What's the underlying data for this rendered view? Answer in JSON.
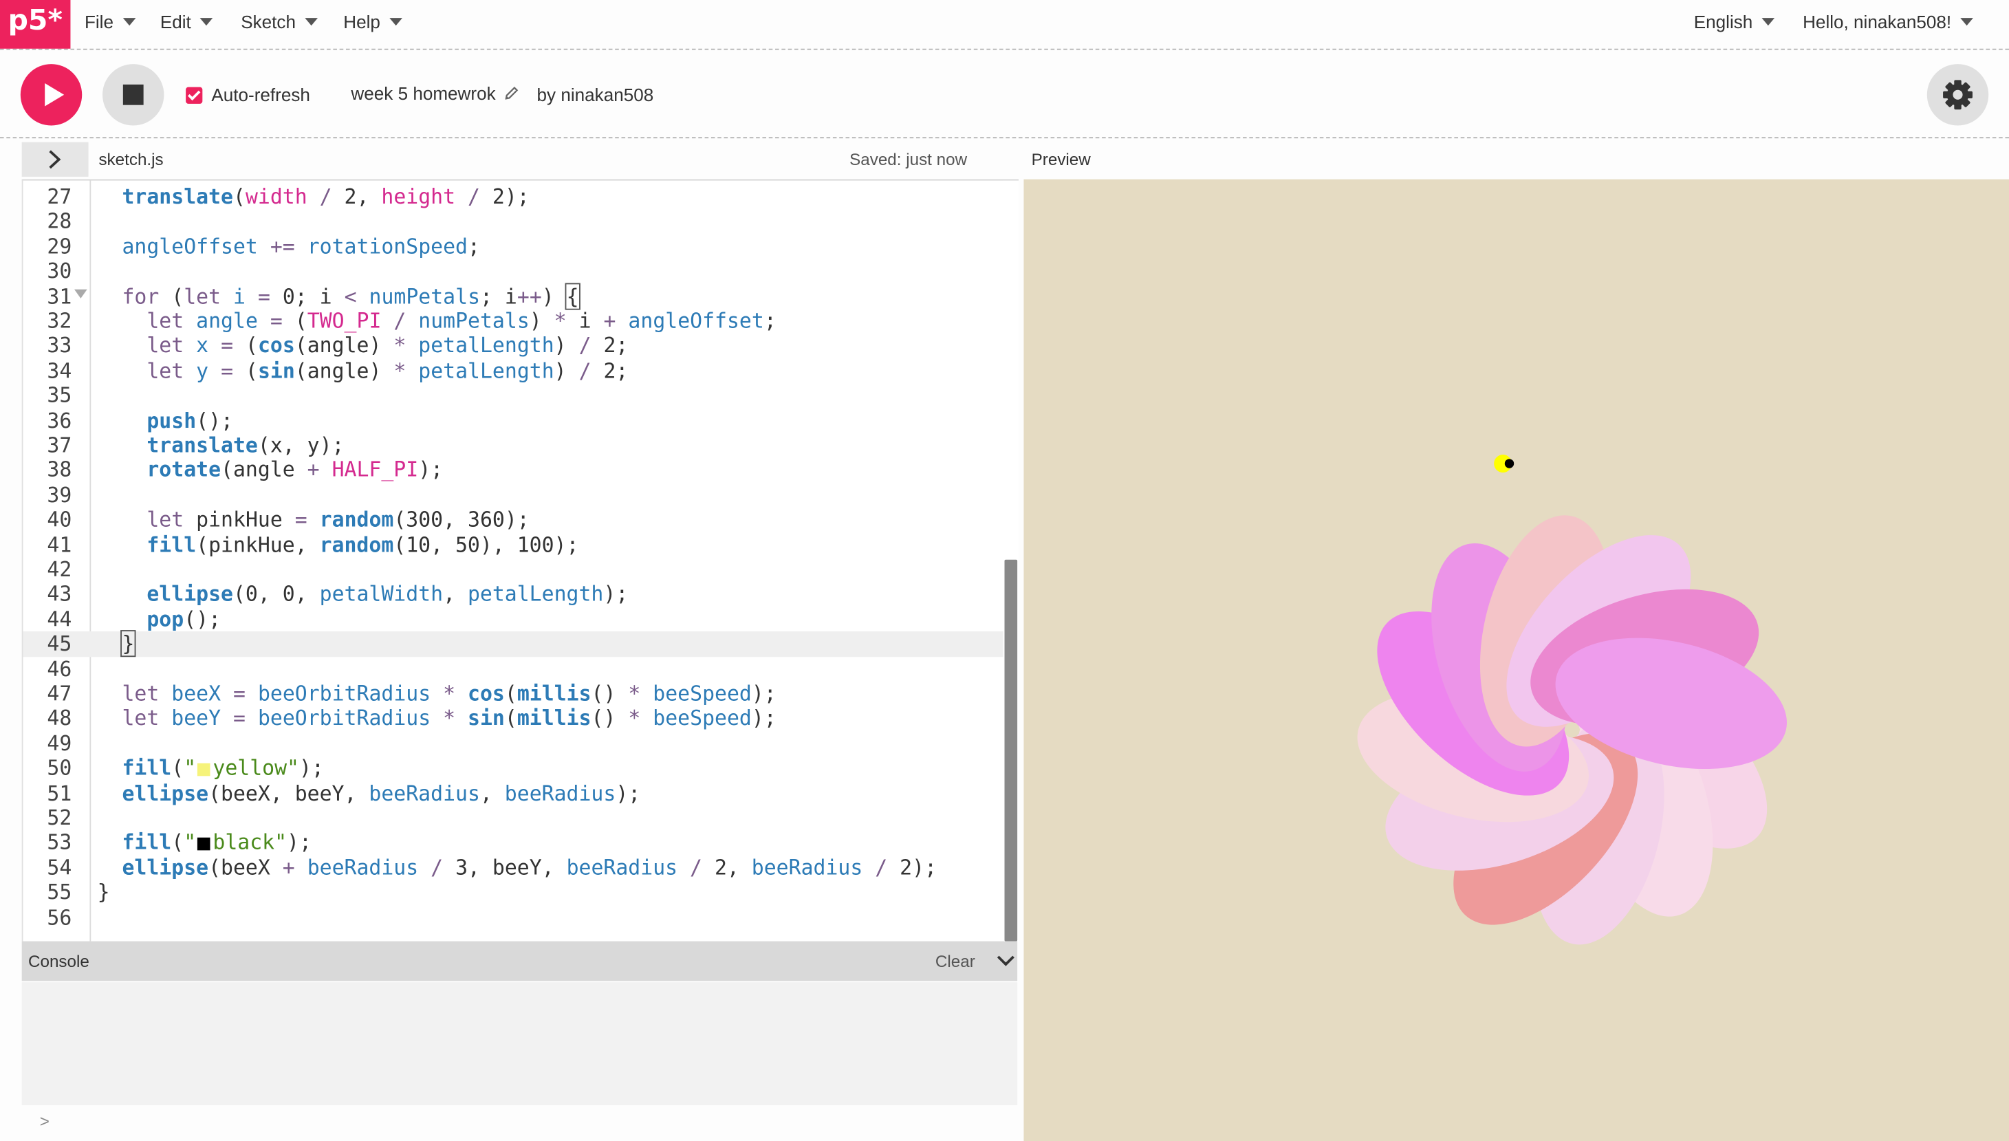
{
  "colors": {
    "accent": "#ed225d",
    "preview_bg": "#e5dbc2"
  },
  "nav": {
    "logo_text": "p5*",
    "menus": [
      "File",
      "Edit",
      "Sketch",
      "Help"
    ],
    "language": "English",
    "user_greeting": "Hello, ninakan508!"
  },
  "toolbar": {
    "play_icon": "play-icon",
    "stop_icon": "stop-icon",
    "auto_refresh_label": "Auto-refresh",
    "auto_refresh_checked": true,
    "sketch_name": "week 5 homewrok",
    "owner_text": "by ninakan508",
    "settings_icon": "gear-icon"
  },
  "editor": {
    "file_name": "sketch.js",
    "saved_status": "Saved: just now",
    "preview_label": "Preview",
    "line_numbers": [
      "27",
      "28",
      "29",
      "30",
      "31",
      "32",
      "33",
      "34",
      "35",
      "36",
      "37",
      "38",
      "39",
      "40",
      "41",
      "42",
      "43",
      "44",
      "45",
      "46",
      "47",
      "48",
      "49",
      "50",
      "51",
      "52",
      "53",
      "54",
      "55",
      "56"
    ],
    "code_lines": [
      "  translate(width / 2, height / 2);",
      "",
      "  angleOffset += rotationSpeed;",
      "",
      "  for (let i = 0; i < numPetals; i++) {",
      "    let angle = (TWO_PI / numPetals) * i + angleOffset;",
      "    let x = (cos(angle) * petalLength) / 2;",
      "    let y = (sin(angle) * petalLength) / 2;",
      "",
      "    push();",
      "    translate(x, y);",
      "    rotate(angle + HALF_PI);",
      "",
      "    let pinkHue = random(300, 360);",
      "    fill(pinkHue, random(10, 50), 100);",
      "",
      "    ellipse(0, 0, petalWidth, petalLength);",
      "    pop();",
      "  }",
      "",
      "  let beeX = beeOrbitRadius * cos(millis() * beeSpeed);",
      "  let beeY = beeOrbitRadius * sin(millis() * beeSpeed);",
      "",
      "  fill(\"yellow\");",
      "  ellipse(beeX, beeY, beeRadius, beeRadius);",
      "",
      "  fill(\"black\");",
      "  ellipse(beeX + beeRadius / 3, beeY, beeRadius / 2, beeRadius / 2);",
      "}",
      ""
    ],
    "active_line": "45"
  },
  "console": {
    "label": "Console",
    "clear_label": "Clear",
    "prompt": ">"
  },
  "preview": {
    "petal_colors": [
      "#f7d5e8",
      "#f8dbe9",
      "#f3d2ea",
      "#ee9a9a",
      "#f3d0ea",
      "#f7d8de",
      "#ee84ee",
      "#ec94e8",
      "#f4c4c8",
      "#f2c6ee",
      "#eb88d0",
      "#ee9cec"
    ],
    "bee_colors": {
      "body": "#ffff00",
      "eye": "#000000"
    }
  }
}
